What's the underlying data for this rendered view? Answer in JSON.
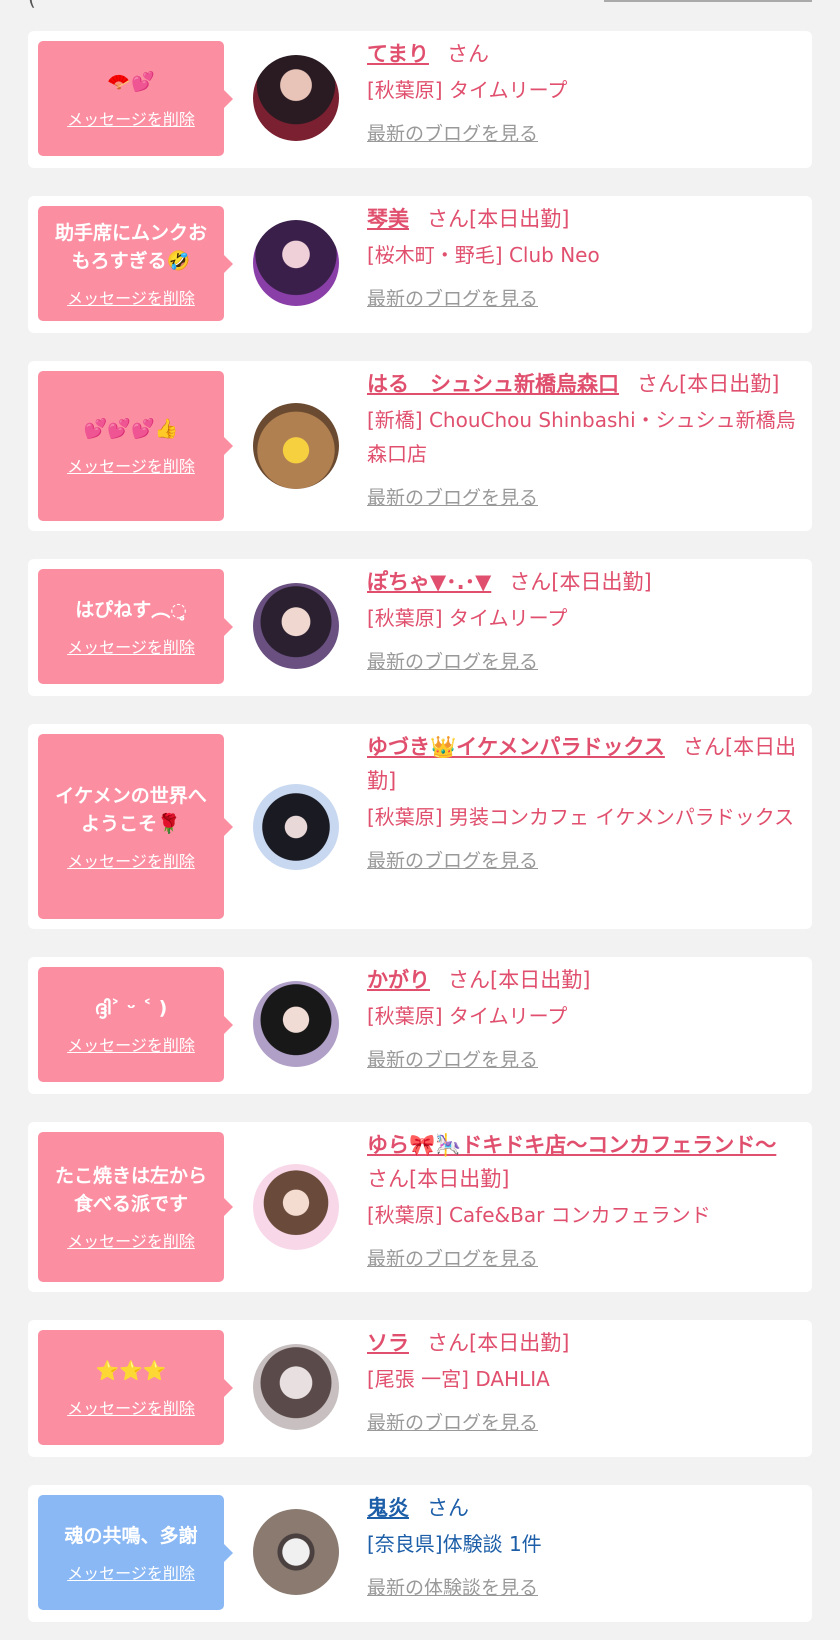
{
  "top_fragment": "(",
  "delete_label": "メッセージを削除",
  "cards": [
    {
      "message": "🪭💕",
      "name": "てまり",
      "suffix": "さん",
      "shop": "[秋葉原] タイムリープ",
      "blog": "最新のブログを見る"
    },
    {
      "message": "助手席にムンクおもろすぎる🤣",
      "name": "琴美",
      "suffix": "さん[本日出勤]",
      "shop": "[桜木町・野毛] Club Neo",
      "blog": "最新のブログを見る"
    },
    {
      "message": "💕💕💕👍",
      "name": "はる　シュシュ新橋烏森口",
      "suffix": "さん[本日出勤]",
      "shop": "[新橋] ChouChou Shinbashi・シュシュ新橋烏森口店",
      "blog": "最新のブログを見る"
    },
    {
      "message": "はぴねす︵◌̥̥̥",
      "name": "ぽちゃ▼･.･▼",
      "suffix": "さん[本日出勤]",
      "shop": "[秋葉原] タイムリープ",
      "blog": "最新のブログを見る"
    },
    {
      "message": "イケメンの世界へようこそ🌹",
      "name": "ゆづき👑イケメンパラドックス",
      "suffix": "さん[本日出勤]",
      "shop": "[秋葉原] 男装コンカフェ イケメンパラドックス",
      "blog": "最新のブログを見る"
    },
    {
      "message": "ദ്ദി˃ ᵕ ˂ )",
      "name": "かがり",
      "suffix": "さん[本日出勤]",
      "shop": "[秋葉原] タイムリープ",
      "blog": "最新のブログを見る"
    },
    {
      "message": "たこ焼きは左から食べる派です",
      "name": "ゆら🎀🎠ドキドキ店〜コンカフェランド〜",
      "suffix": "さん[本日出勤]",
      "shop": "[秋葉原] Cafe&Bar コンカフェランド",
      "blog": "最新のブログを見る"
    },
    {
      "message": "⭐️⭐️⭐️",
      "name": "ソラ",
      "suffix": "さん[本日出勤]",
      "shop": "[尾張 一宮] DAHLIA",
      "blog": "最新のブログを見る"
    },
    {
      "message": "魂の共鳴、多謝",
      "name": "鬼炎",
      "suffix": "さん",
      "shop": "[奈良県]体験談 1件",
      "blog": "最新の体験談を見る"
    }
  ],
  "colors": {
    "pink_bubble": "#fb8fa1",
    "blue_bubble": "#8ab8f4",
    "pink_text": "#e0506e",
    "blue_text": "#1d5ea8"
  }
}
